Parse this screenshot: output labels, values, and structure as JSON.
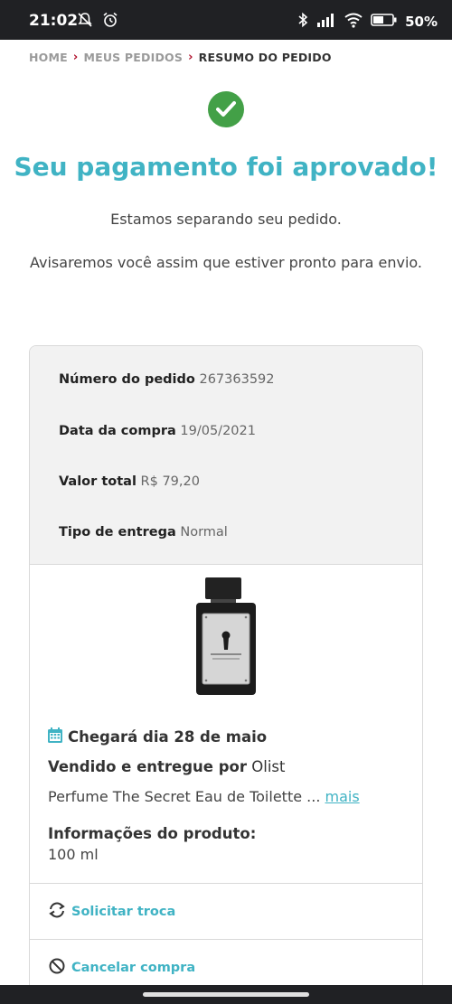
{
  "status_bar": {
    "time": "21:02",
    "battery": "50%",
    "icons": [
      "notifications-off-icon",
      "alarm-icon",
      "bluetooth-icon",
      "signal-icon",
      "wifi-icon",
      "battery-icon"
    ]
  },
  "breadcrumb": {
    "items": [
      "HOME",
      "MEUS PEDIDOS",
      "RESUMO DO PEDIDO"
    ]
  },
  "confirmation": {
    "title": "Seu pagamento foi aprovado!",
    "line1": "Estamos separando seu pedido.",
    "line2": "Avisaremos você assim que estiver pronto para envio."
  },
  "order": {
    "number_label": "Número do pedido",
    "number_value": "267363592",
    "date_label": "Data da compra",
    "date_value": "19/05/2021",
    "total_label": "Valor total",
    "total_value": "R$ 79,20",
    "delivery_label": "Tipo de entrega",
    "delivery_value": "Normal"
  },
  "item": {
    "arrival": "Chegará dia 28 de maio",
    "seller_label": "Vendido e entregue por",
    "seller_value": "Olist",
    "name": "Perfume The Secret Eau de Toilette ...",
    "more_link": "mais",
    "info_title": "Informações do produto:",
    "info_value": "100 ml"
  },
  "actions": {
    "exchange": "Solicitar troca",
    "cancel": "Cancelar compra"
  },
  "colors": {
    "accent": "#40b3c4",
    "success": "#43a047",
    "breadcrumb_separator": "#b0102b",
    "status_bar": "#202124"
  }
}
